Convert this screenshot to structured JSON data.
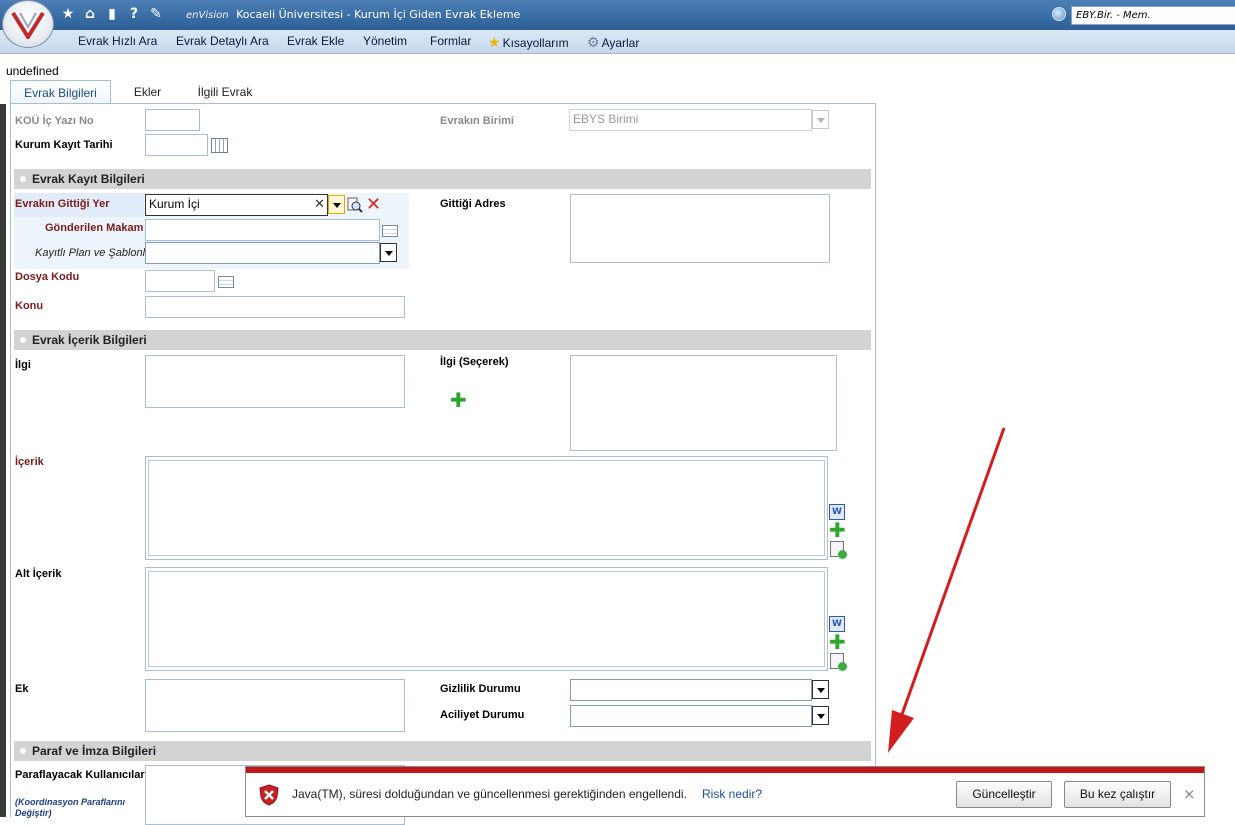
{
  "window": {
    "brand": "enVision",
    "title": "Kocaeli Üniversitesi - Kurum İçi Giden Evrak Ekleme",
    "user": "EBY.Bir. - Mem."
  },
  "quick_icons": [
    "star-icon",
    "home-icon",
    "trash-icon",
    "help-icon",
    "pin-icon"
  ],
  "menu": {
    "items": [
      "Evrak Hızlı Ara",
      "Evrak Detaylı Ara",
      "Evrak Ekle",
      "Yönetim",
      "Formlar",
      "Kısayollarım",
      "Ayarlar"
    ]
  },
  "page": {
    "undefined_text": "undefined",
    "tabs": [
      "Evrak Bilgileri",
      "Ekler",
      "İlgili Evrak"
    ]
  },
  "form": {
    "kou_yazi_no": "KOÜ İç Yazı No",
    "evrakin_birimi": "Evrakın Birimi",
    "evrakin_birimi_value": "EBYS Birimi",
    "kurum_kayit_tarihi": "Kurum Kayıt Tarihi",
    "section_kayit": "Evrak Kayıt Bilgileri",
    "gittigi_yer": "Evrakın Gittiği Yer",
    "gittigi_yer_value": "Kurum İçi",
    "gittigi_adres": "Gittiği Adres",
    "gonderilen_makam": "Gönderilen Makam",
    "kayitli_plan": "Kayıtlı Plan ve Şablonlar",
    "dosya_kodu": "Dosya Kodu",
    "konu": "Konu",
    "section_icerik": "Evrak İçerik Bilgileri",
    "ilgi": "İlgi",
    "ilgi_secerek": "İlgi (Seçerek)",
    "icerik": "İçerik",
    "alt_icerik": "Alt İçerik",
    "ek": "Ek",
    "gizlilik": "Gizlilik Durumu",
    "aciliyet": "Aciliyet Durumu",
    "section_paraf": "Paraf ve İmza Bilgileri",
    "paraflayacak": "Paraflayacak Kullanıcılar",
    "koordinasyon": "(Koordinasyon Paraflarını Değiştir)"
  },
  "notification": {
    "message": "Java(TM), süresi dolduğundan ve güncellenmesi gerektiğinden engellendi.",
    "risk_link": "Risk nedir?",
    "update_button": "Güncelleştir",
    "run_once_button": "Bu kez çalıştır",
    "close_glyph": "×"
  },
  "colors": {
    "titlebar": "#2d5f95",
    "menubar": "#c6d8ee",
    "section_bar": "#d3d3d3",
    "required_label": "#7b1c1c",
    "notification_strip": "#c0151b",
    "arrow": "#d21e1e"
  }
}
